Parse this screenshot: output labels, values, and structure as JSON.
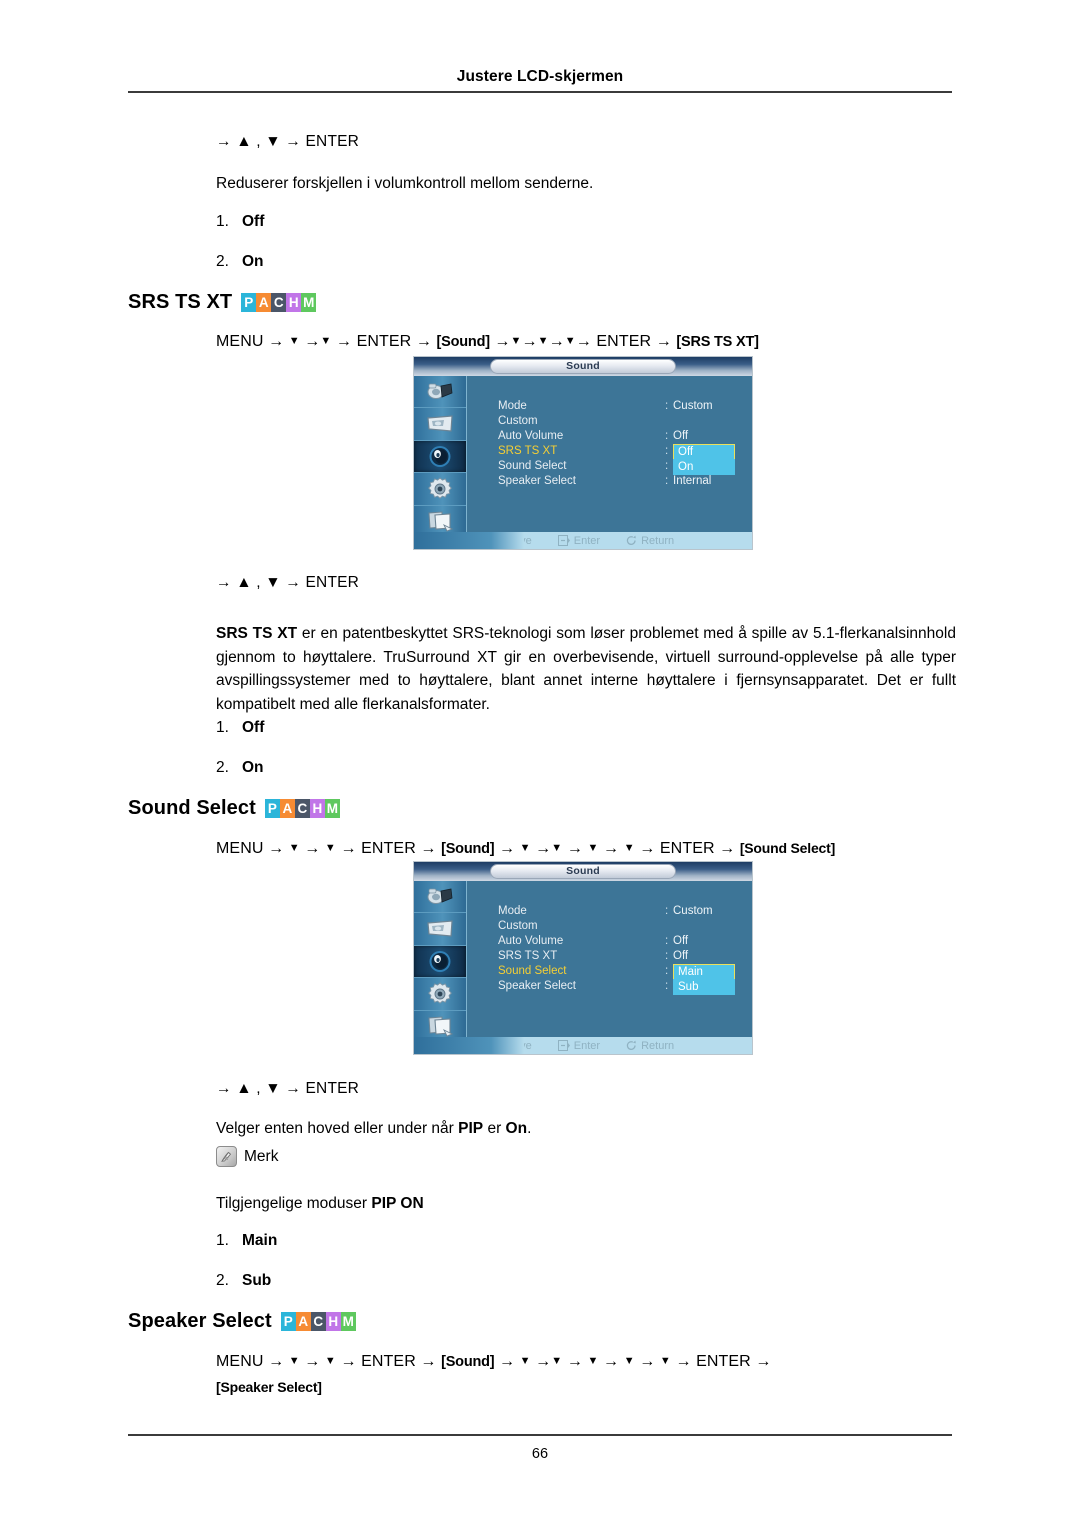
{
  "document": {
    "header_title": "Justere LCD-skjermen",
    "page_number": "66"
  },
  "badge": {
    "letters": [
      "P",
      "A",
      "C",
      "H",
      "M"
    ],
    "colors": [
      "#2bb5d9",
      "#f68b33",
      "#4b5668",
      "#c175e8",
      "#5ec85e"
    ]
  },
  "intro": {
    "key_line": "→ ▲ , ▼ → ENTER",
    "description": "Reduserer forskjellen i volumkontroll mellom senderne.",
    "options": [
      {
        "num": "1.",
        "value": "Off"
      },
      {
        "num": "2.",
        "value": "On"
      }
    ]
  },
  "srs": {
    "heading": "SRS TS XT",
    "menu_path": {
      "start": "MENU",
      "enter1": "ENTER",
      "sound_tag": "[Sound]",
      "enter2": "ENTER",
      "end_tag": "[SRS TS XT]"
    },
    "key_line": "→ ▲ , ▼ → ENTER",
    "paragraph_bold": "SRS TS XT",
    "paragraph": " er en patentbeskyttet SRS-teknologi som løser problemet med å spille av 5.1-flerkanalsinnhold gjennom to høyttalere. TruSurround XT gir en overbevisende, virtuell surround-opplevelse på alle typer avspillingssystemer med to høyttalere, blant annet interne høyttalere i fjernsynsapparatet. Det er fullt kompatibelt med alle flerkanalsformater.",
    "options": [
      {
        "num": "1.",
        "value": "Off"
      },
      {
        "num": "2.",
        "value": "On"
      }
    ],
    "osd": {
      "title": "Sound",
      "rows": [
        {
          "label": "Mode",
          "colon": ":",
          "value": "Custom",
          "state": "normal",
          "value_style": "plain"
        },
        {
          "label": "Custom",
          "colon": "",
          "value": "",
          "state": "normal",
          "value_style": "plain"
        },
        {
          "label": "Auto Volume",
          "colon": ":",
          "value": "Off",
          "state": "normal",
          "value_style": "plain"
        },
        {
          "label": "SRS TS XT",
          "colon": ":",
          "value": "Off",
          "state": "active",
          "value_style": "selected"
        },
        {
          "label": "Sound Select",
          "colon": ":",
          "value": "On",
          "state": "normal",
          "value_style": "highlight"
        },
        {
          "label": "Speaker Select",
          "colon": ":",
          "value": "Internal",
          "state": "normal",
          "value_style": "plain"
        }
      ],
      "footer": [
        {
          "icon": "move-icon",
          "label": "Move"
        },
        {
          "icon": "enter-icon",
          "label": "Enter"
        },
        {
          "icon": "return-icon",
          "label": "Return"
        }
      ]
    }
  },
  "sound_select": {
    "heading": "Sound Select",
    "menu_path": {
      "start": "MENU",
      "enter1": "ENTER",
      "sound_tag": "[Sound]",
      "enter2": "ENTER",
      "end_tag": "[Sound Select]"
    },
    "key_line": "→ ▲ , ▼ → ENTER",
    "description_pre": "Velger enten hoved eller under når ",
    "description_bold1": "PIP",
    "description_mid": " er ",
    "description_bold2": "On",
    "description_post": ".",
    "note_label": "Merk",
    "note_text_pre": "Tilgjengelige moduser ",
    "note_text_bold": "PIP ON",
    "options": [
      {
        "num": "1.",
        "value": "Main"
      },
      {
        "num": "2.",
        "value": "Sub"
      }
    ],
    "osd": {
      "title": "Sound",
      "rows": [
        {
          "label": "Mode",
          "colon": ":",
          "value": "Custom",
          "state": "normal",
          "value_style": "plain"
        },
        {
          "label": "Custom",
          "colon": "",
          "value": "",
          "state": "normal",
          "value_style": "plain"
        },
        {
          "label": "Auto Volume",
          "colon": ":",
          "value": "Off",
          "state": "normal",
          "value_style": "plain"
        },
        {
          "label": "SRS TS XT",
          "colon": ":",
          "value": "Off",
          "state": "normal",
          "value_style": "plain"
        },
        {
          "label": "Sound Select",
          "colon": ":",
          "value": "Main",
          "state": "active",
          "value_style": "selected"
        },
        {
          "label": "Speaker Select",
          "colon": ":",
          "value": "Sub",
          "state": "normal",
          "value_style": "highlight"
        }
      ],
      "footer": [
        {
          "icon": "move-icon",
          "label": "Move"
        },
        {
          "icon": "enter-icon",
          "label": "Enter"
        },
        {
          "icon": "return-icon",
          "label": "Return"
        }
      ]
    }
  },
  "speaker_select": {
    "heading": "Speaker Select",
    "menu_path": {
      "start": "MENU",
      "enter1": "ENTER",
      "sound_tag": "[Sound]",
      "enter2": "ENTER",
      "end_tag": "[Speaker Select]"
    }
  },
  "glyphs": {
    "arrow": "→",
    "tri_up": "▲",
    "tri_down": "▼",
    "comma": ","
  }
}
